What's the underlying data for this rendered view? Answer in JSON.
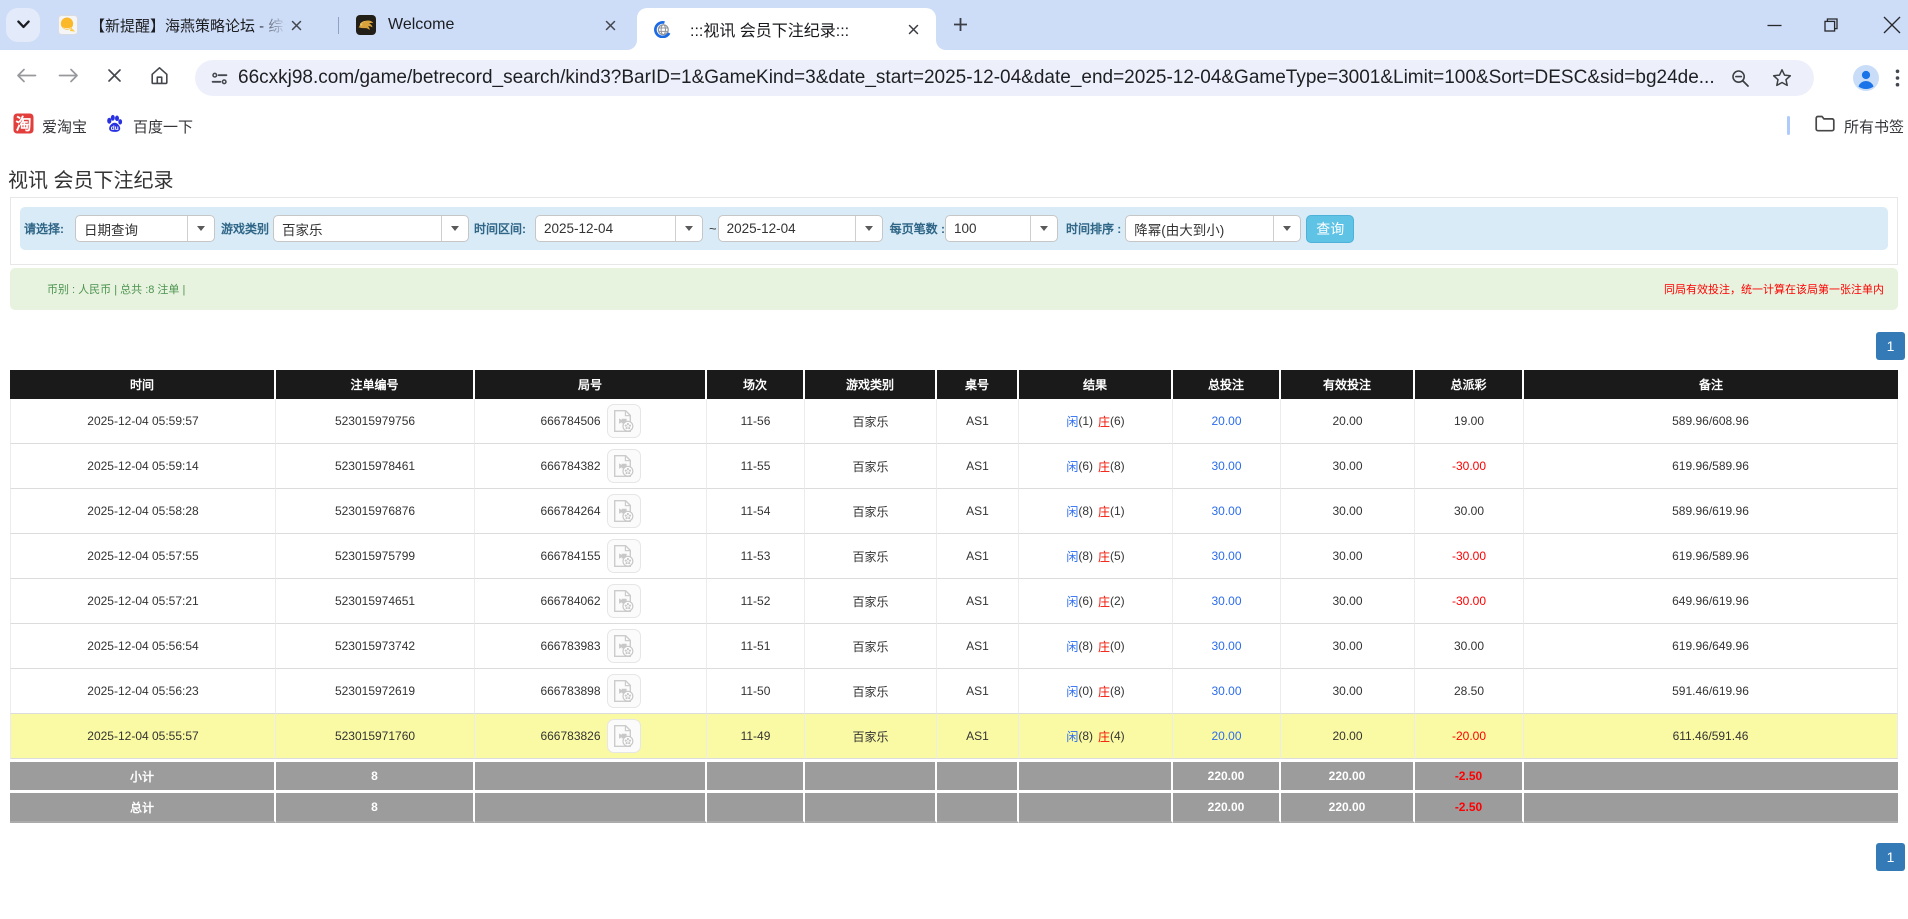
{
  "colors": {
    "strip_bg": "#cddcf7",
    "chevron_pill": "#e3ebfb",
    "urlbar_bg": "#edf0fb",
    "filter_bg": "#d8ebf6",
    "label_blue": "#2f6586",
    "query_btn": "#5fc3e6",
    "query_btn_border": "#4cb2d8",
    "summary_bg": "#e7f3de",
    "summary_green": "#4c9350",
    "pager_blue": "#337ab7",
    "header_bg": "#1a1a1a",
    "summary_gray": "#9c9c9c",
    "highlight_yellow": "#fafaa4",
    "link_blue": "#2c6ced",
    "player_blue": "#2a6bf2",
    "banker_red": "#f00f00"
  },
  "browser": {
    "tabs": [
      {
        "title": "【新提醒】海燕策略论坛 - 综合",
        "favicon": "haiyan-forum-icon"
      },
      {
        "title": "Welcome",
        "favicon": "gold-dragon-icon"
      },
      {
        "title": ":::视讯 会员下注纪录:::",
        "favicon": "loading-spinner-icon",
        "active": true
      }
    ],
    "url": "66cxkj98.com/game/betrecord_search/kind3?BarID=1&GameKind=3&date_start=2025-12-04&date_end=2025-12-04&GameType=3001&Limit=100&Sort=DESC&sid=bg24de...",
    "bookmarks": [
      {
        "label": "爱淘宝",
        "icon": "taobao-icon"
      },
      {
        "label": "百度一下",
        "icon": "baidu-icon"
      }
    ],
    "all_bookmarks_label": "所有书签"
  },
  "page": {
    "title": "视讯 会员下注纪录",
    "filters": {
      "select_label": "请选择:",
      "select_value": "日期查询",
      "game_label": "游戏类别",
      "game_value": "百家乐",
      "range_label": "时间区间:",
      "date_start": "2025-12-04",
      "range_tilde": "~",
      "date_end": "2025-12-04",
      "page_size_label": "每页笔数 :",
      "page_size_value": "100",
      "sort_label": "时间排序 :",
      "sort_value": "降幂(由大到小)",
      "query_label": "查询"
    },
    "summary_bar": {
      "left": "币别 : 人民币 | 总共 :8 注单 |",
      "right": "同局有效投注，统一计算在该局第一张注单内"
    },
    "pagination": "1",
    "table": {
      "headers": [
        "时间",
        "注单编号",
        "局号",
        "场次",
        "游戏类别",
        "桌号",
        "结果",
        "总投注",
        "有效投注",
        "总派彩",
        "备注"
      ],
      "result_labels": {
        "player": "闲",
        "banker": "庄"
      },
      "rows": [
        {
          "time": "2025-12-04 05:59:57",
          "bet_id": "523015979756",
          "round": "666784506",
          "session": "11-56",
          "game": "百家乐",
          "table": "AS1",
          "player": "1",
          "banker": "6",
          "total": "20.00",
          "valid": "20.00",
          "payout": "19.00",
          "payout_negative": false,
          "note": "589.96/608.96",
          "highlighted": false
        },
        {
          "time": "2025-12-04 05:59:14",
          "bet_id": "523015978461",
          "round": "666784382",
          "session": "11-55",
          "game": "百家乐",
          "table": "AS1",
          "player": "6",
          "banker": "8",
          "total": "30.00",
          "valid": "30.00",
          "payout": "-30.00",
          "payout_negative": true,
          "note": "619.96/589.96",
          "highlighted": false
        },
        {
          "time": "2025-12-04 05:58:28",
          "bet_id": "523015976876",
          "round": "666784264",
          "session": "11-54",
          "game": "百家乐",
          "table": "AS1",
          "player": "8",
          "banker": "1",
          "total": "30.00",
          "valid": "30.00",
          "payout": "30.00",
          "payout_negative": false,
          "note": "589.96/619.96",
          "highlighted": false
        },
        {
          "time": "2025-12-04 05:57:55",
          "bet_id": "523015975799",
          "round": "666784155",
          "session": "11-53",
          "game": "百家乐",
          "table": "AS1",
          "player": "8",
          "banker": "5",
          "total": "30.00",
          "valid": "30.00",
          "payout": "-30.00",
          "payout_negative": true,
          "note": "619.96/589.96",
          "highlighted": false
        },
        {
          "time": "2025-12-04 05:57:21",
          "bet_id": "523015974651",
          "round": "666784062",
          "session": "11-52",
          "game": "百家乐",
          "table": "AS1",
          "player": "6",
          "banker": "2",
          "total": "30.00",
          "valid": "30.00",
          "payout": "-30.00",
          "payout_negative": true,
          "note": "649.96/619.96",
          "highlighted": false
        },
        {
          "time": "2025-12-04 05:56:54",
          "bet_id": "523015973742",
          "round": "666783983",
          "session": "11-51",
          "game": "百家乐",
          "table": "AS1",
          "player": "8",
          "banker": "0",
          "total": "30.00",
          "valid": "30.00",
          "payout": "30.00",
          "payout_negative": false,
          "note": "619.96/649.96",
          "highlighted": false
        },
        {
          "time": "2025-12-04 05:56:23",
          "bet_id": "523015972619",
          "round": "666783898",
          "session": "11-50",
          "game": "百家乐",
          "table": "AS1",
          "player": "0",
          "banker": "8",
          "total": "30.00",
          "valid": "30.00",
          "payout": "28.50",
          "payout_negative": false,
          "note": "591.46/619.96",
          "highlighted": false
        },
        {
          "time": "2025-12-04 05:55:57",
          "bet_id": "523015971760",
          "round": "666783826",
          "session": "11-49",
          "game": "百家乐",
          "table": "AS1",
          "player": "8",
          "banker": "4",
          "total": "20.00",
          "valid": "20.00",
          "payout": "-20.00",
          "payout_negative": true,
          "note": "611.46/591.46",
          "highlighted": true
        }
      ],
      "subtotal": {
        "label": "小计",
        "count": "8",
        "total": "220.00",
        "valid": "220.00",
        "payout": "-2.50"
      },
      "total": {
        "label": "总计",
        "count": "8",
        "total": "220.00",
        "valid": "220.00",
        "payout": "-2.50"
      }
    }
  }
}
